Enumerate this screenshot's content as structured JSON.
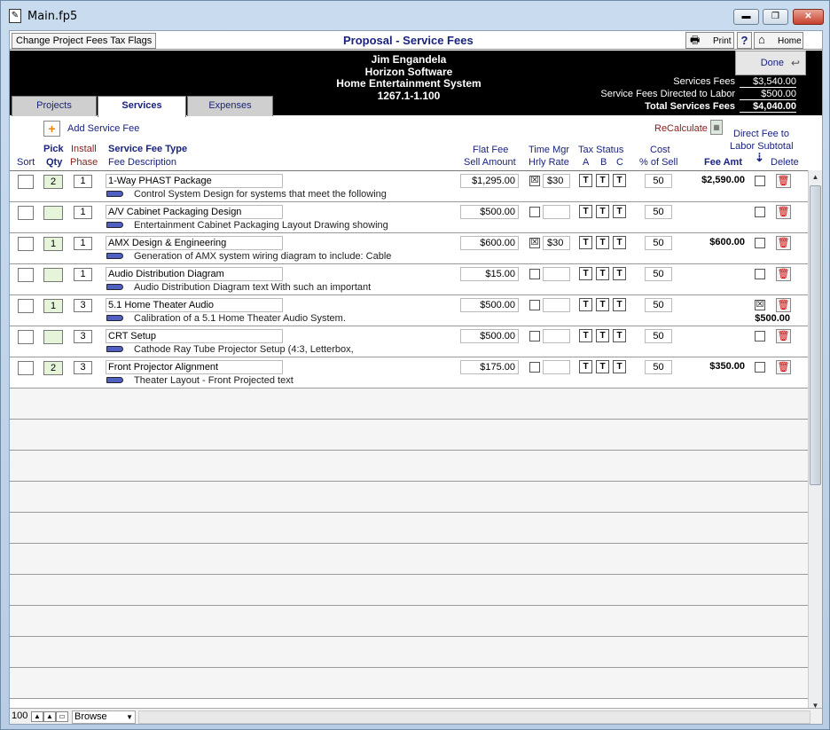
{
  "window": {
    "title": "Main.fp5",
    "min": "▬",
    "max": "❐",
    "close": "✕"
  },
  "toolbar": {
    "tax_flags": "Change Project Fees Tax Flags",
    "page_title": "Proposal - Service Fees",
    "print": "Print",
    "help": "?",
    "home": "Home"
  },
  "header": {
    "client": "Jim Engandela",
    "company": "Horizon Software",
    "project": "Home Entertainment System",
    "number": "1267.1-1.100",
    "done": "Done",
    "totals": [
      {
        "label": "Services Fees",
        "value": "$3,540.00"
      },
      {
        "label": "Service Fees Directed to Labor",
        "value": "$500.00"
      },
      {
        "label": "Total Services Fees",
        "value": "$4,040.00"
      }
    ]
  },
  "tabs": [
    {
      "label": "Projects"
    },
    {
      "label": "Services"
    },
    {
      "label": "Expenses"
    }
  ],
  "actions": {
    "add": "Add Service Fee",
    "recalc": "ReCalculate"
  },
  "columns": {
    "sort": "Sort",
    "pick": "Pick",
    "qty": "Qty",
    "install": "Install",
    "phase": "Phase",
    "type": "Service Fee Type",
    "desc": "Fee Description",
    "flat": "Flat Fee",
    "sell": "Sell Amount",
    "time": "Time Mgr",
    "hrly": "Hrly Rate",
    "tax": "Tax Status",
    "a": "A",
    "b": "B",
    "c": "C",
    "cost": "Cost",
    "pct": "% of Sell",
    "amt": "Fee Amt",
    "direct1": "Direct Fee to",
    "direct2": "Labor Subtotal",
    "del": "Delete"
  },
  "rows": [
    {
      "qty": "2",
      "phase": "1",
      "type": "1-Way PHAST Package",
      "desc": "Control System Design for systems that meet the following",
      "fee": "$1,295.00",
      "time": "☒",
      "rate": "$30",
      "ta": "T",
      "tb": "T",
      "tc": "T",
      "cost": "50",
      "amt": "$2,590.00",
      "direct": "",
      "direct_amt": ""
    },
    {
      "qty": "",
      "phase": "1",
      "type": "A/V Cabinet Packaging Design",
      "desc": "Entertainment Cabinet Packaging Layout Drawing showing",
      "fee": "$500.00",
      "time": "",
      "rate": "",
      "ta": "T",
      "tb": "T",
      "tc": "T",
      "cost": "50",
      "amt": "",
      "direct": "",
      "direct_amt": ""
    },
    {
      "qty": "1",
      "phase": "1",
      "type": "AMX Design & Engineering",
      "desc": "Generation of AMX system wiring diagram to include: Cable",
      "fee": "$600.00",
      "time": "☒",
      "rate": "$30",
      "ta": "T",
      "tb": "T",
      "tc": "T",
      "cost": "50",
      "amt": "$600.00",
      "direct": "",
      "direct_amt": ""
    },
    {
      "qty": "",
      "phase": "1",
      "type": "Audio Distribution Diagram",
      "desc": "Audio Distribution Diagram text  With such an important",
      "fee": "$15.00",
      "time": "",
      "rate": "",
      "ta": "T",
      "tb": "T",
      "tc": "T",
      "cost": "50",
      "amt": "",
      "direct": "",
      "direct_amt": ""
    },
    {
      "qty": "1",
      "phase": "3",
      "type": "5.1 Home Theater Audio",
      "desc": "Calibration of a 5.1 Home Theater Audio System.",
      "fee": "$500.00",
      "time": "",
      "rate": "",
      "ta": "T",
      "tb": "T",
      "tc": "T",
      "cost": "50",
      "amt": "",
      "direct": "☒",
      "direct_amt": "$500.00"
    },
    {
      "qty": "",
      "phase": "3",
      "type": "CRT Setup",
      "desc": "Cathode Ray Tube Projector Setup  (4:3, Letterbox,",
      "fee": "$500.00",
      "time": "",
      "rate": "",
      "ta": "T",
      "tb": "T",
      "tc": "T",
      "cost": "50",
      "amt": "",
      "direct": "",
      "direct_amt": ""
    },
    {
      "qty": "2",
      "phase": "3",
      "type": "Front Projector Alignment",
      "desc": "Theater Layout - Front Projected text",
      "fee": "$175.00",
      "time": "",
      "rate": "",
      "ta": "T",
      "tb": "T",
      "tc": "T",
      "cost": "50",
      "amt": "$350.00",
      "direct": "",
      "direct_amt": ""
    }
  ],
  "empty_rows": 10,
  "status": {
    "zoom": "100",
    "mode": "Browse"
  },
  "colors": {
    "header_bg": "#000000",
    "label_blue": "#1a237e",
    "label_red": "#8b1a1a",
    "qty_bg": "#e6f5d9"
  }
}
